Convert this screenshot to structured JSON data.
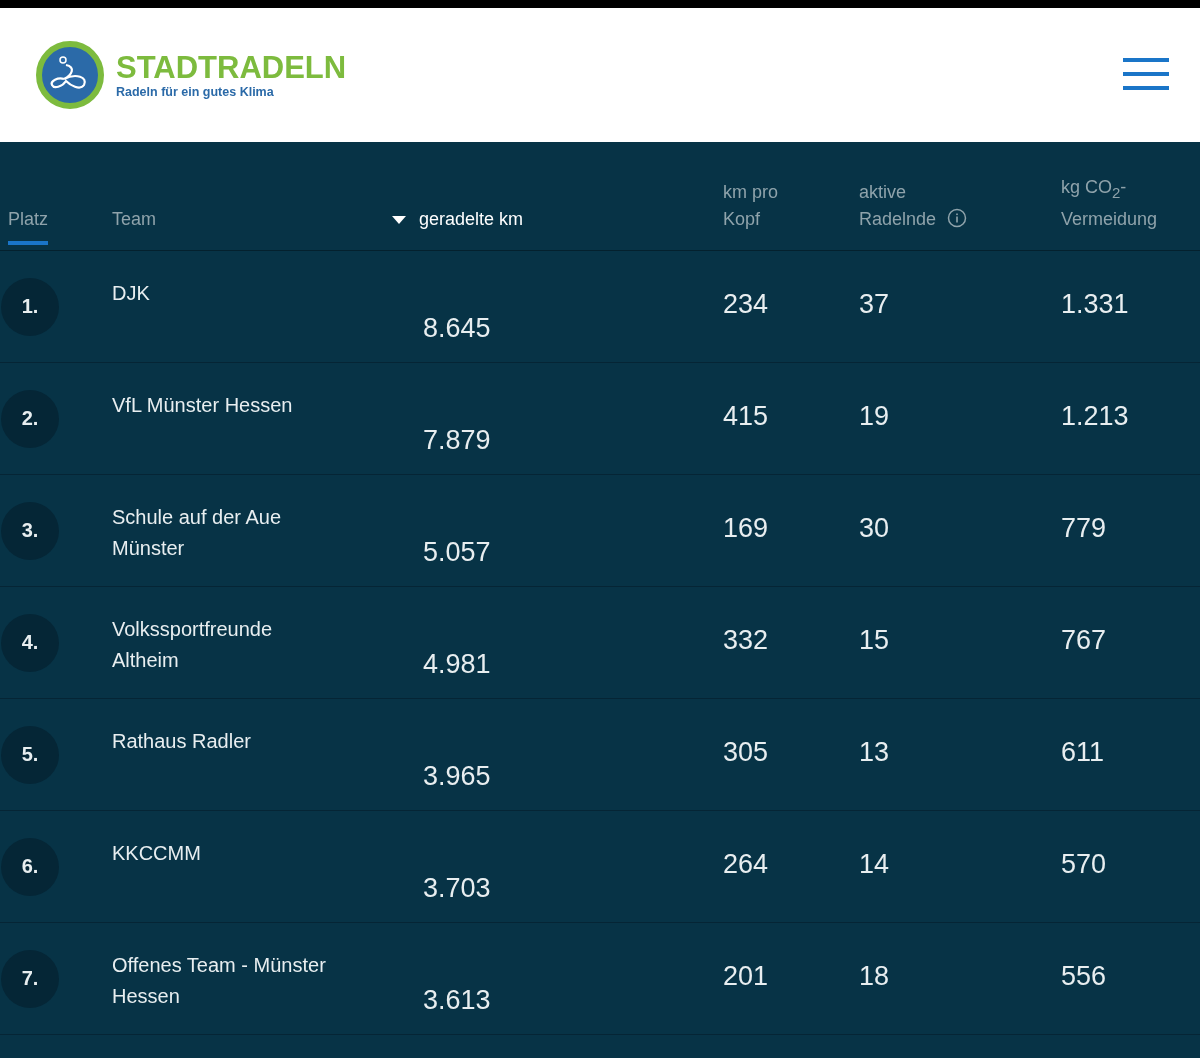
{
  "header": {
    "logo_title": "STADTRADELN",
    "logo_tagline": "Radeln für ein gutes Klima"
  },
  "table": {
    "columns": [
      {
        "label": "Platz",
        "selected": true,
        "sorted": false,
        "info": false
      },
      {
        "label": "Team",
        "selected": false,
        "sorted": false,
        "info": false
      },
      {
        "label": "geradelte km",
        "selected": false,
        "sorted": true,
        "info": false
      },
      {
        "label": "km pro Kopf",
        "selected": false,
        "sorted": false,
        "info": false
      },
      {
        "label": "aktive Radelnde",
        "selected": false,
        "sorted": false,
        "info": true
      },
      {
        "label": "kg CO$_{2}$-Vermeidung",
        "selected": false,
        "sorted": false,
        "info": false
      }
    ],
    "rows": [
      {
        "rank": "1.",
        "team": "DJK",
        "km": "8.645",
        "km_per_head": "234",
        "active": "37",
        "co2": "1.331"
      },
      {
        "rank": "2.",
        "team": "VfL Münster Hessen",
        "km": "7.879",
        "km_per_head": "415",
        "active": "19",
        "co2": "1.213"
      },
      {
        "rank": "3.",
        "team": "Schule auf der Aue Münster",
        "km": "5.057",
        "km_per_head": "169",
        "active": "30",
        "co2": "779"
      },
      {
        "rank": "4.",
        "team": "Volkssportfreunde Altheim",
        "km": "4.981",
        "km_per_head": "332",
        "active": "15",
        "co2": "767"
      },
      {
        "rank": "5.",
        "team": "Rathaus Radler",
        "km": "3.965",
        "km_per_head": "305",
        "active": "13",
        "co2": "611"
      },
      {
        "rank": "6.",
        "team": "KKCCMM",
        "km": "3.703",
        "km_per_head": "264",
        "active": "14",
        "co2": "570"
      },
      {
        "rank": "7.",
        "team": "Offenes Team - Münster Hessen",
        "km": "3.613",
        "km_per_head": "201",
        "active": "18",
        "co2": "556"
      }
    ]
  }
}
